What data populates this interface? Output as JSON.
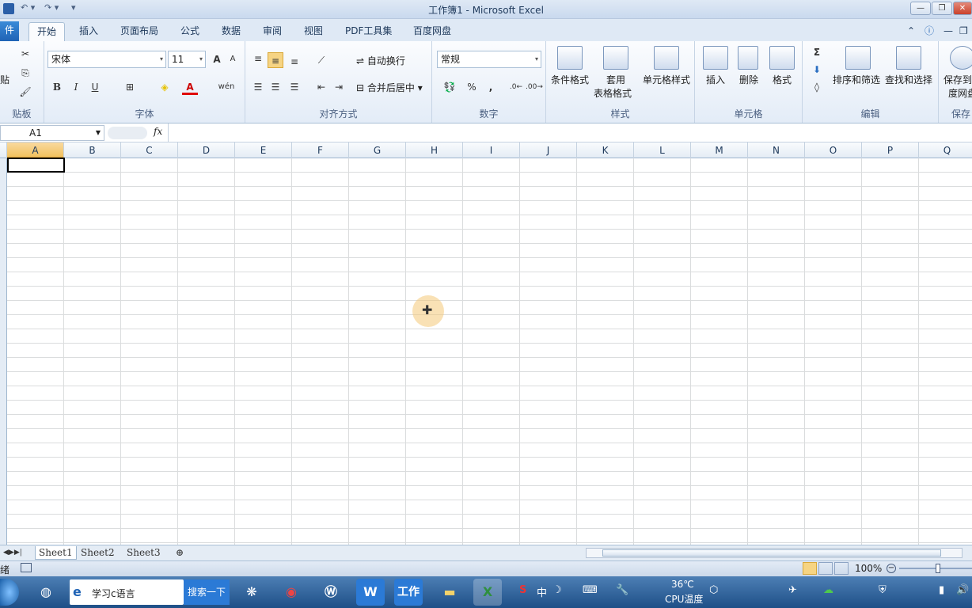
{
  "window": {
    "title": "工作簿1 - Microsoft Excel"
  },
  "tabs": [
    {
      "label": "件",
      "id": "file"
    },
    {
      "label": "开始",
      "id": "home"
    },
    {
      "label": "插入",
      "id": "insert"
    },
    {
      "label": "页面布局",
      "id": "layout"
    },
    {
      "label": "公式",
      "id": "formulas"
    },
    {
      "label": "数据",
      "id": "data"
    },
    {
      "label": "审阅",
      "id": "review"
    },
    {
      "label": "视图",
      "id": "view"
    },
    {
      "label": "PDF工具集",
      "id": "pdf"
    },
    {
      "label": "百度网盘",
      "id": "baidu"
    }
  ],
  "ribbon": {
    "clipboard": {
      "label": "贴板",
      "paste_fragment": "贴"
    },
    "font": {
      "label": "字体",
      "family": "宋体",
      "size": "11",
      "bold": "B",
      "italic": "I",
      "underline": "U",
      "grow": "A",
      "shrink": "A",
      "font_color": "A",
      "wen": "wén"
    },
    "align": {
      "label": "对齐方式",
      "wrap": "自动换行",
      "merge": "合并后居中"
    },
    "number": {
      "label": "数字",
      "format": "常规",
      "percent": "%",
      "comma": ","
    },
    "styles": {
      "label": "样式",
      "cond": "条件格式",
      "table1": "套用",
      "table2": "表格格式",
      "cell_style": "单元格样式"
    },
    "cells": {
      "label": "单元格",
      "insert": "插入",
      "delete": "删除",
      "format": "格式"
    },
    "editing": {
      "label": "编辑",
      "sum": "Σ",
      "sort": "排序和筛选",
      "find": "查找和选择"
    },
    "save": {
      "label": "保存",
      "line1": "保存到",
      "line2": "度网盘"
    }
  },
  "formula_bar": {
    "namebox": "A1",
    "fx": "fx",
    "value": ""
  },
  "columns": [
    "A",
    "B",
    "C",
    "D",
    "E",
    "F",
    "G",
    "H",
    "I",
    "J",
    "K",
    "L",
    "M",
    "N",
    "O",
    "P",
    "Q"
  ],
  "selected_cell": "A1",
  "sheets": [
    "Sheet1",
    "Sheet2",
    "Sheet3"
  ],
  "status": {
    "ready": "绪",
    "zoom": "100%"
  },
  "taskbar": {
    "ie_text": "学习c语言",
    "search_btn": "搜索一下",
    "work_label": "工作",
    "temp": "36℃",
    "cpu": "CPU温度",
    "ime": "中"
  }
}
